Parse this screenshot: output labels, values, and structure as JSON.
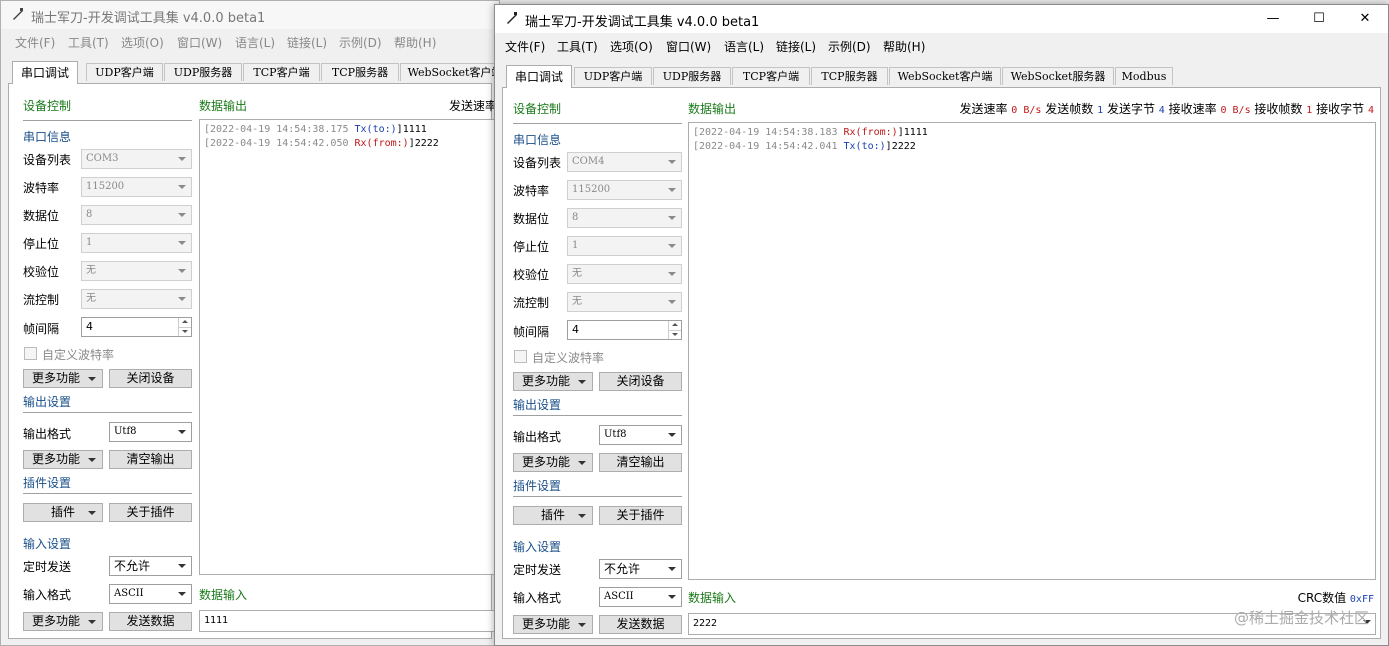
{
  "app_title": "瑞士军刀-开发调试工具集 v4.0.0 beta1",
  "menu": [
    "文件(F)",
    "工具(T)",
    "选项(O)",
    "窗口(W)",
    "语言(L)",
    "链接(L)",
    "示例(D)",
    "帮助(H)"
  ],
  "window_controls": {
    "minimize": "—",
    "maximize": "☐",
    "close": "✕"
  },
  "tabs": [
    "串口调试",
    "UDP客户端",
    "UDP服务器",
    "TCP客户端",
    "TCP服务器",
    "WebSocket客户端",
    "WebSocket服务器",
    "Modbus"
  ],
  "labels": {
    "device_control": "设备控制",
    "serial_info": "串口信息",
    "port_list": "设备列表",
    "baud": "波特率",
    "data_bits": "数据位",
    "stop_bits": "停止位",
    "parity": "校验位",
    "flow": "流控制",
    "frame_interval": "帧间隔",
    "custom_baud": "自定义波特率",
    "more": "更多功能",
    "close_device": "关闭设备",
    "output_settings": "输出设置",
    "output_format": "输出格式",
    "clear_output": "清空输出",
    "plugin_settings": "插件设置",
    "plugin": "插件",
    "about_plugin": "关于插件",
    "input_settings": "输入设置",
    "timed_send": "定时发送",
    "input_format": "输入格式",
    "send_data": "发送数据",
    "data_output": "数据输出",
    "data_input": "数据输入",
    "send_rate": "发送速率",
    "send_frames": "发送帧数",
    "send_bytes": "发送字节",
    "recv_rate": "接收速率",
    "recv_frames": "接收帧数",
    "recv_bytes": "接收字节",
    "crc": "CRC数值"
  },
  "back_window": {
    "port": "COM3",
    "baud": "115200",
    "data_bits": "8",
    "stop_bits": "1",
    "parity": "无",
    "flow": "无",
    "frame_interval": "4",
    "output_format": "Utf8",
    "timed_send": "不允许",
    "input_format": "ASCII",
    "input_value": "1111",
    "log": [
      {
        "ts": "[2022-04-19 14:54:38.175 ",
        "dir": "Tx(to:)",
        "dir_type": "tx",
        "data": "]1111"
      },
      {
        "ts": "[2022-04-19 14:54:42.050 ",
        "dir": "Rx(from:)",
        "dir_type": "rx",
        "data": "]2222"
      }
    ]
  },
  "front_window": {
    "port": "COM4",
    "baud": "115200",
    "data_bits": "8",
    "stop_bits": "1",
    "parity": "无",
    "flow": "无",
    "frame_interval": "4",
    "output_format": "Utf8",
    "timed_send": "不允许",
    "input_format": "ASCII",
    "input_value": "2222",
    "crc_value": "0xFF",
    "stats": {
      "send_rate": "0 B/s",
      "send_frames": "1",
      "send_bytes": "4",
      "recv_rate": "0 B/s",
      "recv_frames": "1",
      "recv_bytes": "4"
    },
    "log": [
      {
        "ts": "[2022-04-19 14:54:38.183 ",
        "dir": "Rx(from:)",
        "dir_type": "rx",
        "data": "]1111"
      },
      {
        "ts": "[2022-04-19 14:54:42.041 ",
        "dir": "Tx(to:)",
        "dir_type": "tx",
        "data": "]2222"
      }
    ]
  },
  "watermark": "@稀土掘金技术社区",
  "colors": {
    "section_green": "#1a7a1a",
    "subsection_blue": "#1a4f8a",
    "tx_blue": "#1a3fb0",
    "rx_red": "#c01818"
  }
}
